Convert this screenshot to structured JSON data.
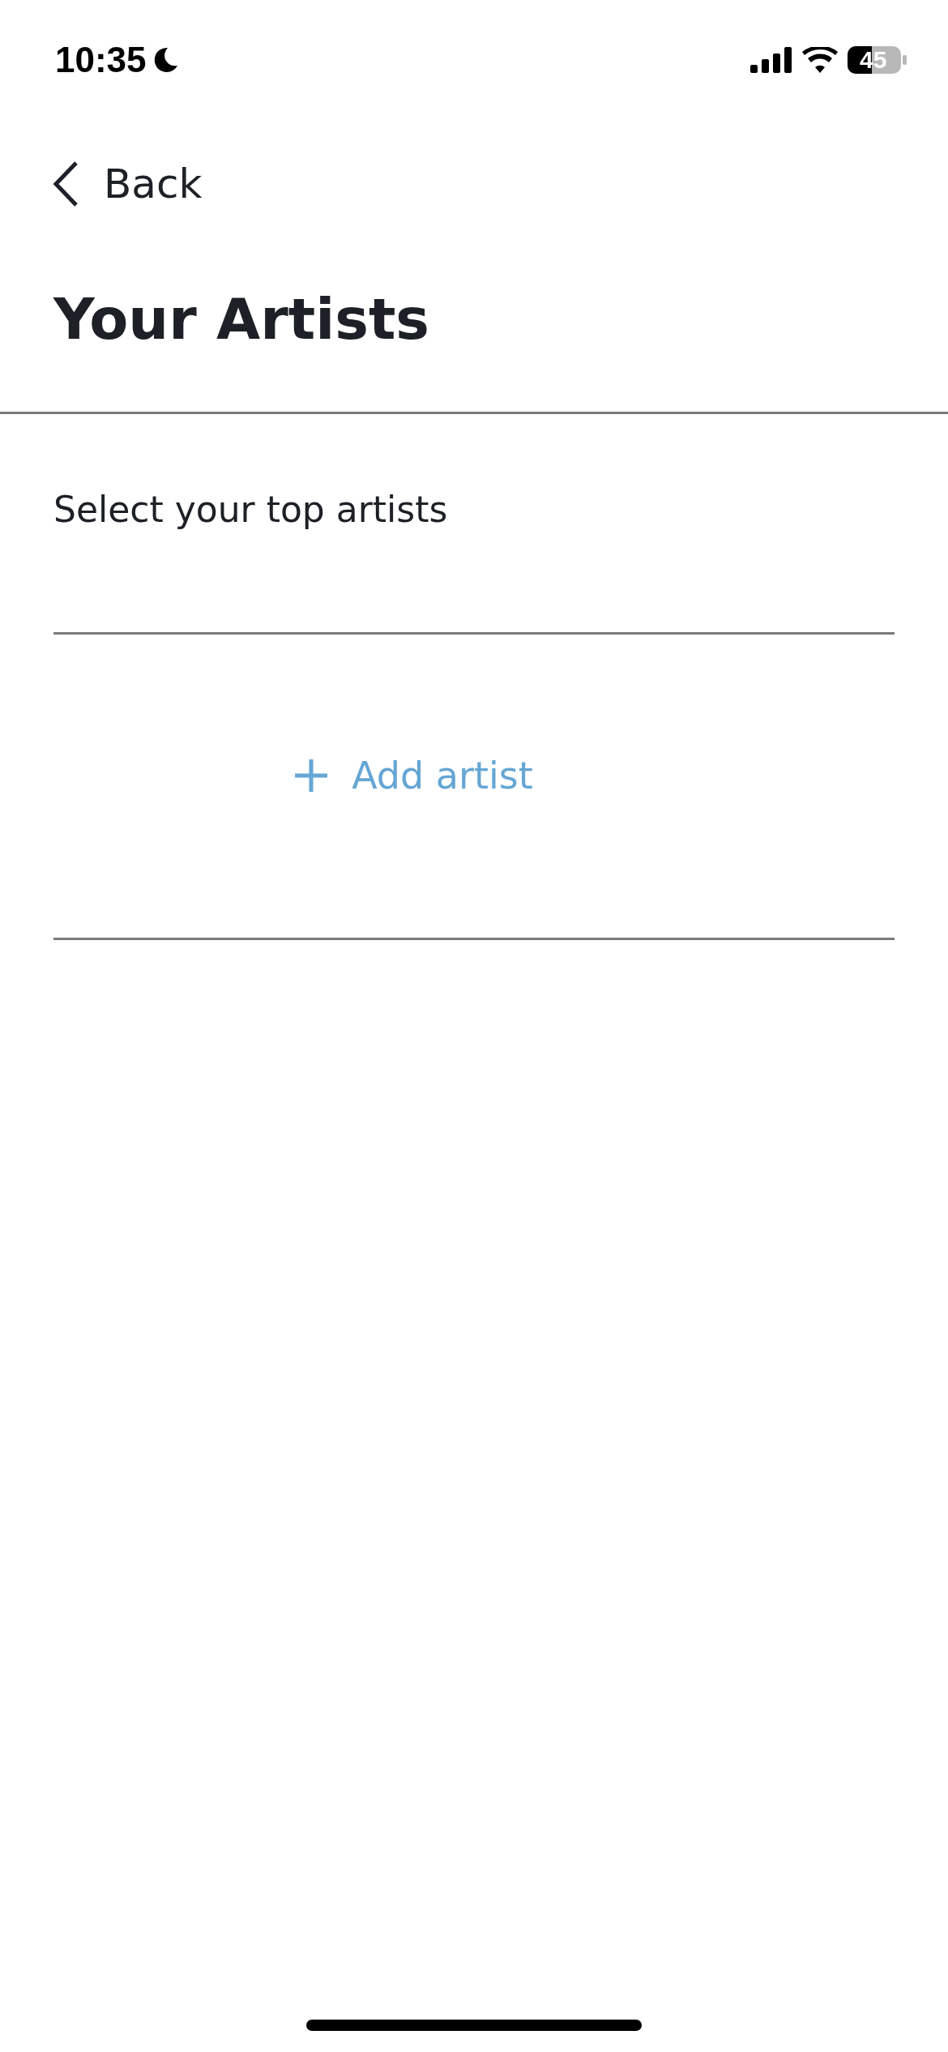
{
  "status_bar": {
    "time": "10:35",
    "battery": "45"
  },
  "nav": {
    "back": "Back"
  },
  "title": "Your Artists",
  "section": {
    "label": "Select your top artists",
    "add_button": "Add artist"
  }
}
